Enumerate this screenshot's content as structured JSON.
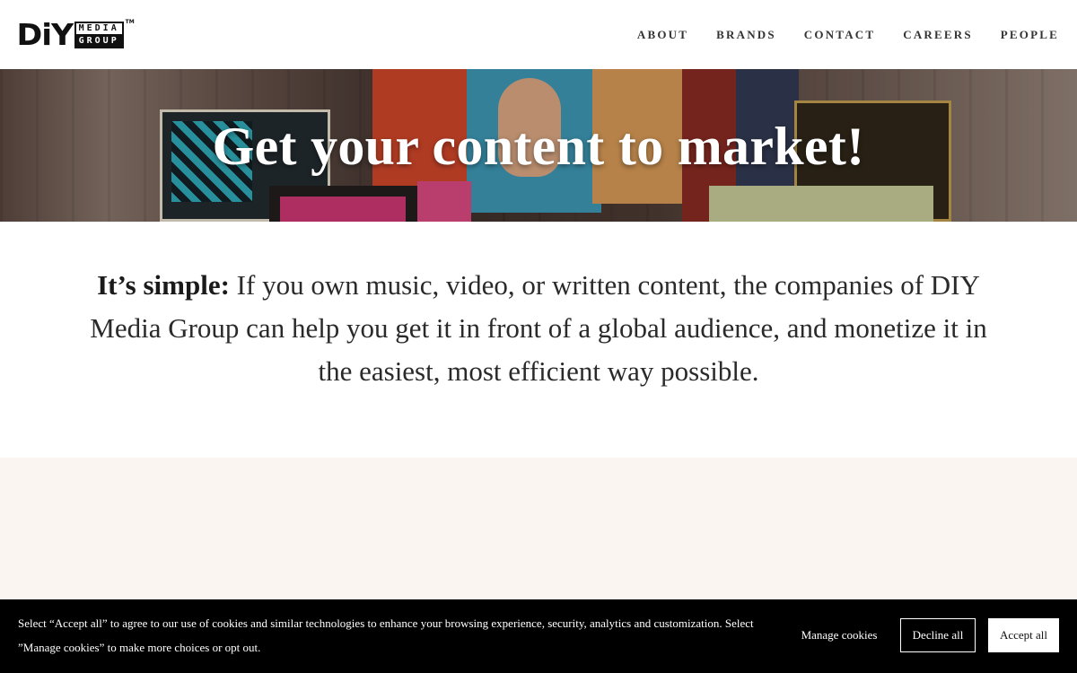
{
  "header": {
    "logo": {
      "main": "DiY",
      "line1": "MEDIA",
      "line2": "GROUP",
      "tm": "TM"
    },
    "nav": [
      {
        "label": "ABOUT"
      },
      {
        "label": "BRANDS"
      },
      {
        "label": "CONTACT"
      },
      {
        "label": "CAREERS"
      },
      {
        "label": "PEOPLE"
      }
    ]
  },
  "hero": {
    "title": "Get your content to market!"
  },
  "intro": {
    "lead": "It’s simple:",
    "body": " If you own music, video, or written content, the companies of DIY Media Group can help you get it in front of a global audience, and monetize it in the easiest, most efficient way possible."
  },
  "cookie_banner": {
    "text": "Select “Accept all” to agree to our use of cookies and similar technologies to enhance your browsing experience, security, analytics and customization. Select ”Manage cookies” to make more choices or opt out.",
    "manage_label": "Manage cookies",
    "decline_label": "Decline all",
    "accept_label": "Accept all"
  },
  "colors": {
    "cookie_bg": "#000000",
    "band_bg": "#faf5f0",
    "nav_text": "#333333"
  }
}
